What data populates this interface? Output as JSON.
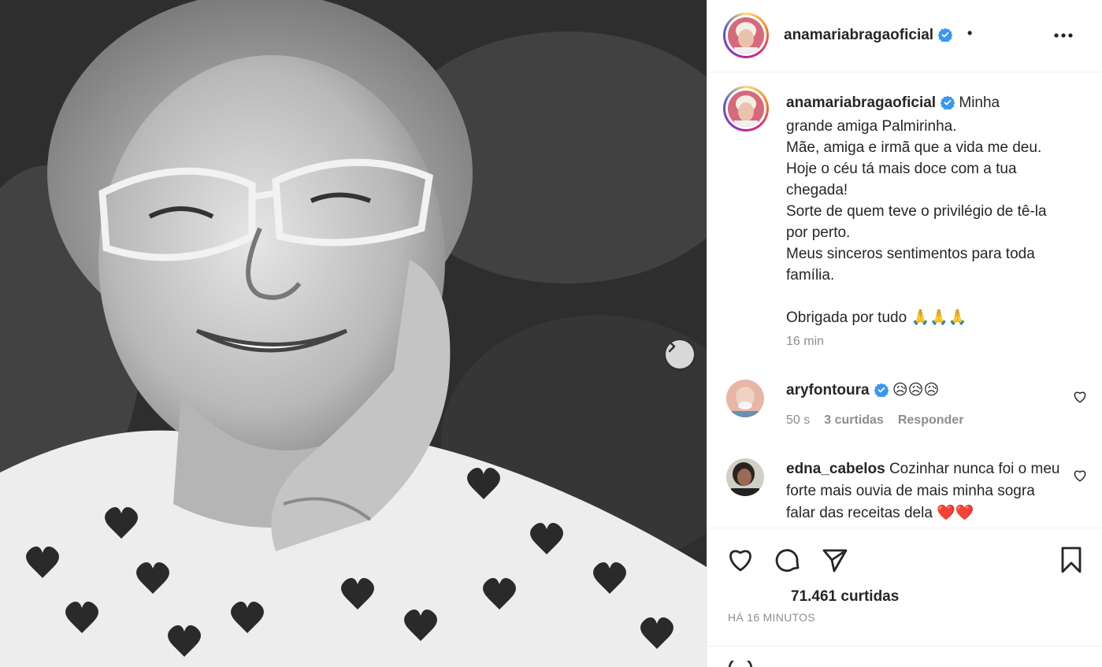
{
  "post": {
    "username": "anamariabragaoficial",
    "header_separator": "•",
    "caption_lines": "Minha\ngrande amiga Palmirinha.\nMãe, amiga e irmã que a vida me deu.\nHoje o céu tá mais doce com a tua chegada!\nSorte de quem teve o privilégio de tê-la por perto.\nMeus sinceros sentimentos para toda família.\n\nObrigada por tudo 🙏🙏🙏",
    "caption_time": "16 min",
    "likes": "71.461 curtidas",
    "posted_ago": "HÁ 16 MINUTOS"
  },
  "comments": [
    {
      "username": "aryfontoura",
      "text": "😥😥😥",
      "time": "50 s",
      "likes": "3 curtidas",
      "reply": "Responder"
    },
    {
      "username": "edna_cabelos",
      "text": "Cozinhar nunca foi o meu forte mais ouvia de mais minha sogra falar das receitas dela ❤️❤️"
    }
  ],
  "colors": {
    "verified": "#3897f0",
    "muted_text": "#8e8e8e",
    "primary_text": "#262626"
  }
}
